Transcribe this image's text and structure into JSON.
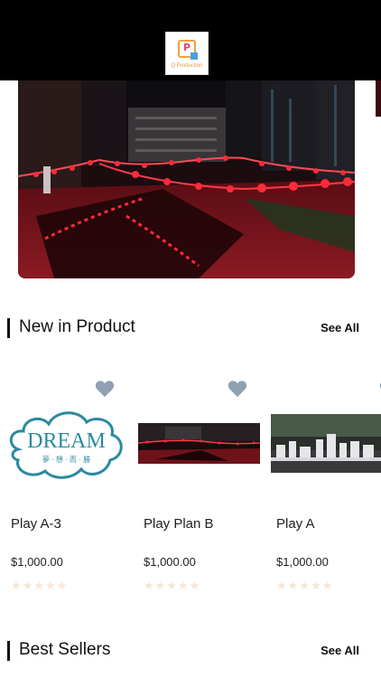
{
  "app": {
    "logo_text": "Q Production"
  },
  "hero": {
    "image_desc": "Night rooftop with red lanterns and reflecting pool"
  },
  "sections": {
    "new_in_product": {
      "title": "New in Product",
      "see_all": "See All"
    },
    "best_sellers": {
      "title": "Best Sellers",
      "see_all": "See All"
    }
  },
  "products": [
    {
      "name": "Play A-3",
      "price": "$1,000.00",
      "rating": 0,
      "image_text": "DREAM",
      "image_subtext": "夢 · 想 · 而 · 勝",
      "icon": "heart-icon"
    },
    {
      "name": "Play Plan B",
      "price": "$1,000.00",
      "rating": 0,
      "icon": "heart-icon"
    },
    {
      "name": "Play A",
      "price": "$1,000.00",
      "rating": 0,
      "icon": "heart-icon"
    }
  ],
  "colors": {
    "accent_lantern": "#ff2a3a",
    "heart": "#8fa1b3",
    "star_empty": "#f6e6d6"
  }
}
